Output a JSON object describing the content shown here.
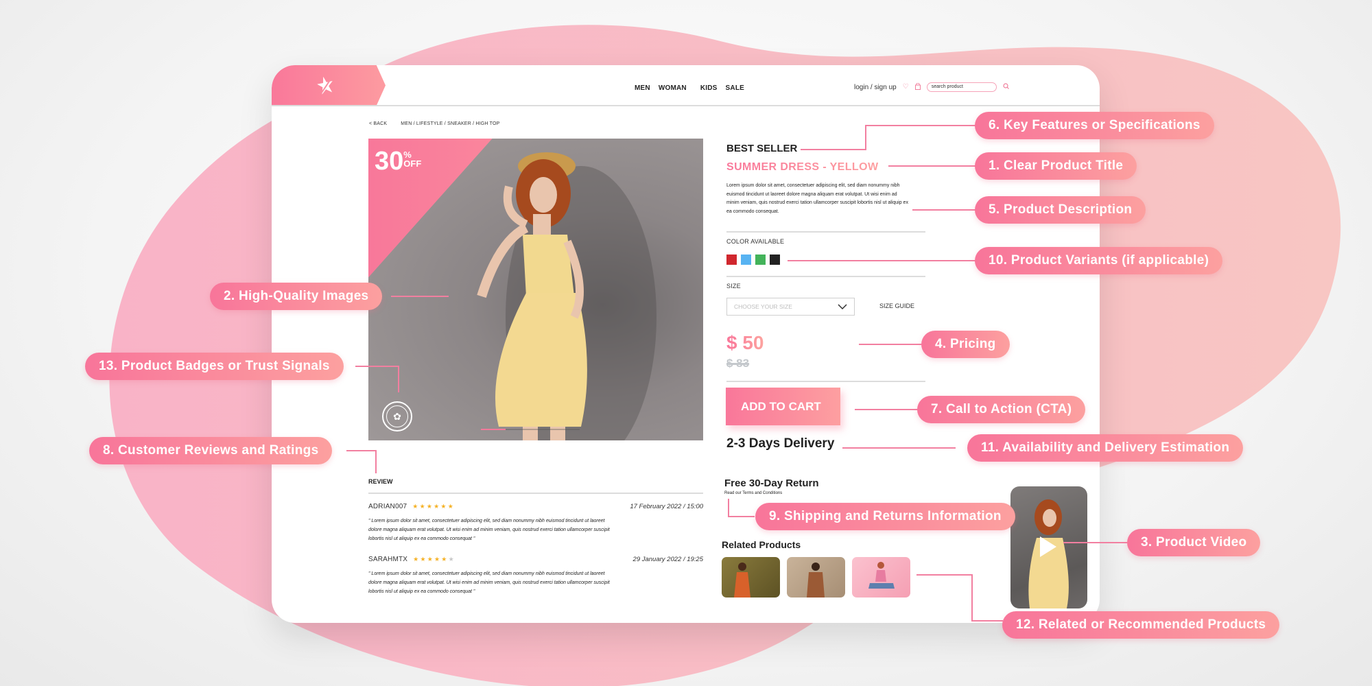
{
  "colors": {
    "brand_pink": "#f8789a",
    "brand_peach": "#fd9ca0",
    "text_dark": "#222222",
    "star_gold": "#f5b227"
  },
  "header": {
    "logo_icon": "star-icon",
    "nav": [
      "MEN",
      "WOMAN",
      "KIDS",
      "SALE"
    ],
    "account_link": "login / sign up",
    "wishlist_icon": "heart-icon",
    "cart_icon": "bag-icon",
    "search_placeholder": "search product",
    "search_icon": "search-icon"
  },
  "breadcrumb": {
    "back": "< BACK",
    "path": "MEN / LIFESTYLE / SNEAKER / HIGH TOP"
  },
  "hero": {
    "discount_value": "30",
    "discount_percent": "%",
    "discount_label": "OFF",
    "badge_icon": "trust-seal-icon",
    "carousel_slides": 4,
    "carousel_active": 1
  },
  "product": {
    "badge": "BEST SELLER",
    "title": "SUMMER DRESS - YELLOW",
    "description": "Lorem ipsum dolor sit amet, consectetuer adipiscing elit, sed diam nonummy nibh euismod tincidunt ut laoreet dolore magna aliquam erat volutpat. Ut wisi enim ad minim veniam, quis nostrud exerci tation ullamcorper suscipit lobortis nisl ut aliquip ex ea commodo consequat.",
    "color_label": "COLOR AVAILABLE",
    "colors": [
      {
        "name": "red",
        "hex": "#d0272e"
      },
      {
        "name": "blue",
        "hex": "#57b3f2"
      },
      {
        "name": "green",
        "hex": "#43b35a"
      },
      {
        "name": "black",
        "hex": "#222222"
      }
    ],
    "size_label": "SIZE",
    "size_placeholder": "CHOOSE YOUR SIZE",
    "size_guide": "SIZE GUIDE",
    "price": "$ 50",
    "old_price": "$ 83",
    "cta": "ADD TO CART",
    "delivery": "2-3 Days Delivery",
    "returns_title": "Free 30-Day Return",
    "returns_link": "Read our Terms and Conditions",
    "related_title": "Related Products",
    "related_count": 3,
    "video_icon": "play-icon"
  },
  "reviews": {
    "heading": "REVIEW",
    "items": [
      {
        "user": "ADRIAN007",
        "rating": 6,
        "max": 6,
        "date": "17 February 2022 / 15:00",
        "text": "\" Lorem ipsum dolor sit amet, consectetuer adipiscing elit, sed diam nonummy nibh euismod tincidunt ut laoreet dolore magna aliquam erat volutpat. Ut wisi enim ad minim veniam, quis nostrud exerci tation ullamcorper suscipit lobortis nisl ut aliquip ex ea commodo consequat \""
      },
      {
        "user": "SARAHMTX",
        "rating": 5,
        "max": 6,
        "date": "29 January 2022 / 19:25",
        "text": "\" Lorem ipsum dolor sit amet, consectetuer adipiscing elit, sed diam nonummy nibh euismod tincidunt ut laoreet dolore magna aliquam erat volutpat. Ut wisi enim ad minim veniam, quis nostrud exerci tation ullamcorper suscipit lobortis nisl ut aliquip ex ea commodo consequat \""
      }
    ]
  },
  "annotations": [
    {
      "id": "key-features",
      "label": "6. Key Features or Specifications"
    },
    {
      "id": "product-title",
      "label": "1. Clear Product Title"
    },
    {
      "id": "description",
      "label": "5. Product Description"
    },
    {
      "id": "variants",
      "label": "10. Product Variants (if applicable)"
    },
    {
      "id": "images",
      "label": "2. High-Quality Images"
    },
    {
      "id": "pricing",
      "label": "4. Pricing"
    },
    {
      "id": "trust-signals",
      "label": "13. Product Badges or Trust Signals"
    },
    {
      "id": "cta",
      "label": "7. Call to Action (CTA)"
    },
    {
      "id": "reviews",
      "label": "8. Customer Reviews and Ratings"
    },
    {
      "id": "delivery",
      "label": "11. Availability and Delivery Estimation"
    },
    {
      "id": "shipping",
      "label": "9. Shipping and Returns Information"
    },
    {
      "id": "video",
      "label": "3. Product Video"
    },
    {
      "id": "related",
      "label": "12. Related or Recommended Products"
    }
  ]
}
